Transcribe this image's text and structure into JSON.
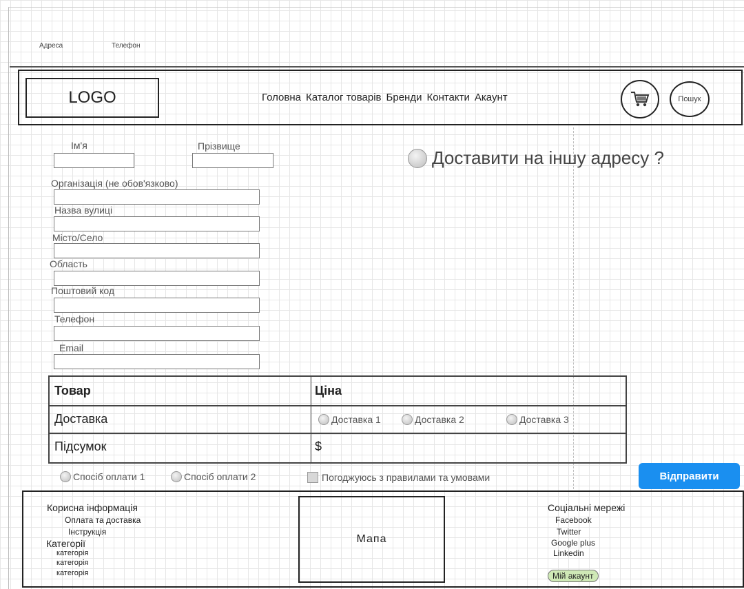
{
  "topbar": {
    "address": "Адреса",
    "phone": "Телефон"
  },
  "header": {
    "logo": "LOGO",
    "nav": [
      "Головна",
      "Каталог товарів",
      "Бренди",
      "Контакти",
      "Акаунт"
    ],
    "search": "Пошук"
  },
  "form": {
    "first_name": "Ім'я",
    "last_name": "Прізвище",
    "organization": "Організація (не обов'язково)",
    "street": "Назва вулиці",
    "city": "Місто/Село",
    "region": "Область",
    "postal": "Поштовий код",
    "phone": "Телефон",
    "email": "Email"
  },
  "deliver_other": "Доставити на іншу адресу ?",
  "order": {
    "col_product": "Товар",
    "col_price": "Ціна",
    "delivery_label": "Доставка",
    "delivery_options": [
      "Доставка 1",
      "Доставка 2",
      "Доставка 3"
    ],
    "total_label": "Підсумок",
    "total_value": "$"
  },
  "payment": {
    "option1": "Спосіб оплати 1",
    "option2": "Спосіб оплати 2"
  },
  "terms": "Погоджуюсь з правилами та умовами",
  "submit": "Відправити",
  "footer": {
    "useful_title": "Корисна інформація",
    "useful_items": [
      "Оплата та доставка",
      "Інструкція"
    ],
    "categories_title": "Категорії",
    "categories_items": [
      "категорія",
      "категорія",
      "категорія"
    ],
    "map": "Мапа",
    "social_title": "Соціальні мережі",
    "social_items": [
      "Facebook",
      "Twitter",
      "Google plus",
      "Linkedin"
    ],
    "my_account": "Мій акаунт"
  }
}
